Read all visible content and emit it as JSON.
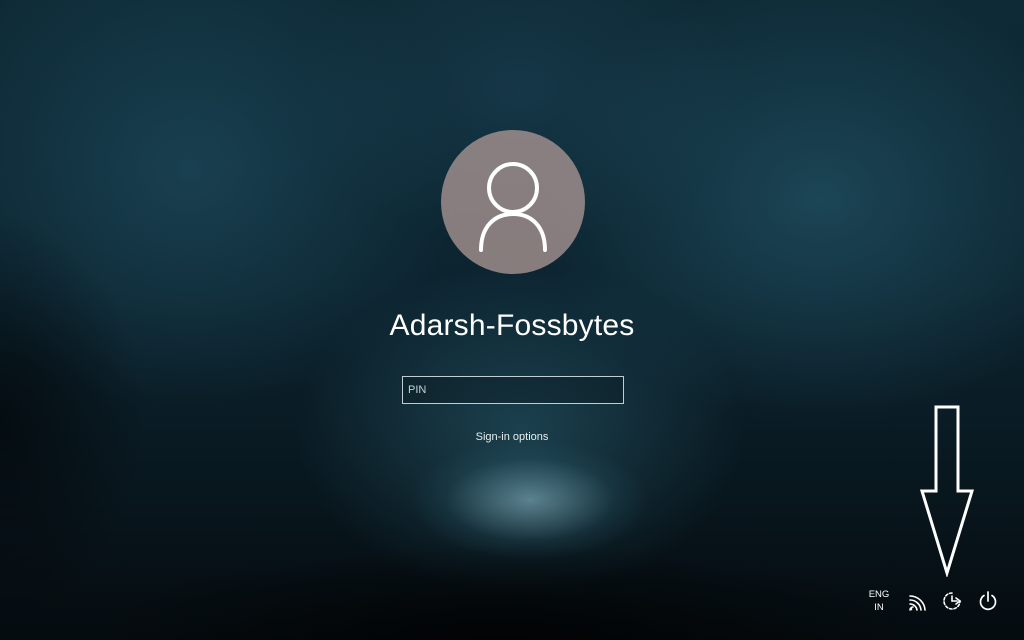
{
  "user": {
    "name": "Adarsh-Fossbytes"
  },
  "pin_field": {
    "placeholder": "PIN",
    "value": ""
  },
  "signin_options": {
    "label": "Sign-in options"
  },
  "tray": {
    "language": {
      "line1": "ENG",
      "line2": "IN"
    },
    "icons": [
      "network-icon",
      "ease-of-access-icon",
      "power-icon"
    ]
  },
  "annotation": {
    "type": "arrow-down",
    "points_to": "ease-of-access-icon"
  }
}
